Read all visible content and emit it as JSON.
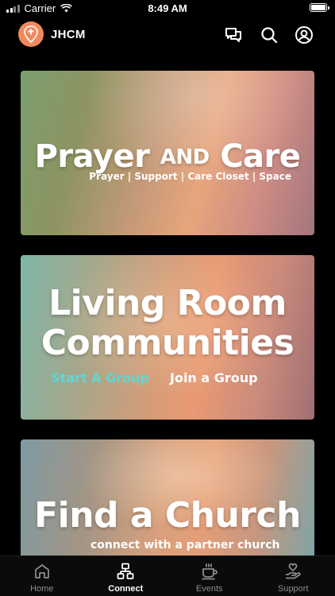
{
  "status_bar": {
    "carrier": "Carrier",
    "time": "8:49 AM"
  },
  "header": {
    "title": "JHCM"
  },
  "cards": [
    {
      "title_word1": "Prayer",
      "title_word2": "AND",
      "title_word3": "Care",
      "subtitle": "Prayer | Support | Care Closet | Space"
    },
    {
      "title_line1": "Living Room",
      "title_line2": "Communities",
      "start_link": "Start A Group",
      "join_link": "Join a Group"
    },
    {
      "title": "Find a Church",
      "subtitle": "connect with a partner church"
    }
  ],
  "tabs": [
    {
      "label": "Home",
      "icon": "home-icon",
      "active": false
    },
    {
      "label": "Connect",
      "icon": "connect-icon",
      "active": true
    },
    {
      "label": "Events",
      "icon": "coffee-cup-icon",
      "active": false
    },
    {
      "label": "Support",
      "icon": "giving-hand-icon",
      "active": false
    }
  ],
  "colors": {
    "accent": "#f08a5d",
    "link_teal": "#5fd7d3",
    "background": "#000000"
  }
}
